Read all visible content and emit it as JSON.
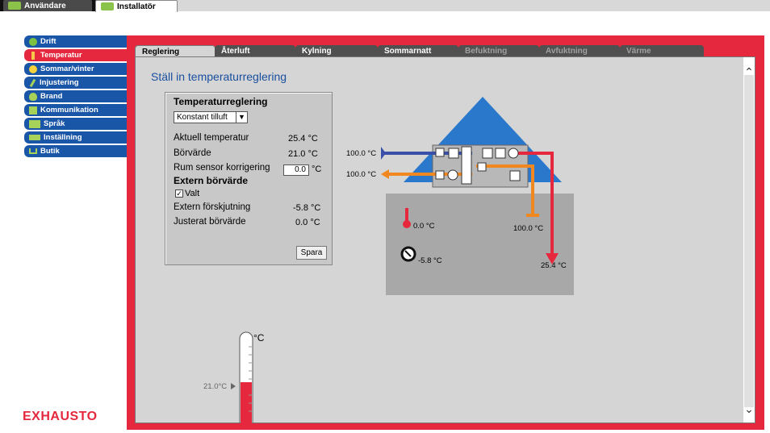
{
  "top_tabs": [
    {
      "label": "Användare"
    },
    {
      "label": "Installatör"
    }
  ],
  "sidebar": {
    "items": [
      {
        "label": "Drift"
      },
      {
        "label": "Temperatur"
      },
      {
        "label": "Sommar/vinter"
      },
      {
        "label": "Injustering"
      },
      {
        "label": "Brand"
      },
      {
        "label": "Kommunikation"
      },
      {
        "label": "Språk"
      },
      {
        "label": "Inställning"
      },
      {
        "label": "Butik"
      }
    ]
  },
  "logo": "EXHAUSTO",
  "content_tabs": [
    {
      "label": "Reglering"
    },
    {
      "label": "Återluft"
    },
    {
      "label": "Kylning"
    },
    {
      "label": "Sommarnatt"
    },
    {
      "label": "Befuktning"
    },
    {
      "label": "Avfuktning"
    },
    {
      "label": "Värme"
    }
  ],
  "page_title": "Ställ in temperaturreglering",
  "settings": {
    "title": "Temperaturreglering",
    "mode_select": "Konstant tilluft",
    "current_temp_label": "Aktuell temperatur",
    "current_temp_value": "25.4 °C",
    "setpoint_label": "Börvärde",
    "setpoint_value": "21.0 °C",
    "room_sensor_label": "Rum sensor korrigering",
    "room_sensor_value": "0.0",
    "room_sensor_unit": "°C",
    "external_setpoint_heading": "Extern börvärde",
    "valt_label": "Valt",
    "valt_checked": "✓",
    "ext_shift_label": "Extern förskjutning",
    "ext_shift_value": "-5.8 °C",
    "adjusted_setpoint_label": "Justerat börvärde",
    "adjusted_setpoint_value": "0.0 °C",
    "save_label": "Spara"
  },
  "diagram": {
    "supply_in_temp": "100.0 °C",
    "exhaust_out_temp": "100.0 °C",
    "outdoor_temp": "0.0 °C",
    "extract_temp": "100.0 °C",
    "shift_temp": "-5.8 °C",
    "supply_temp": "25.4 °C"
  },
  "thermometer": {
    "unit": "°C",
    "setpoint_marker": "21.0°C",
    "fill_fraction": 0.35
  },
  "colors": {
    "accent_red": "#e5283d",
    "nav_blue": "#1a56a8",
    "roof_blue": "#2a78cc",
    "supply_orange": "#f0871f"
  }
}
